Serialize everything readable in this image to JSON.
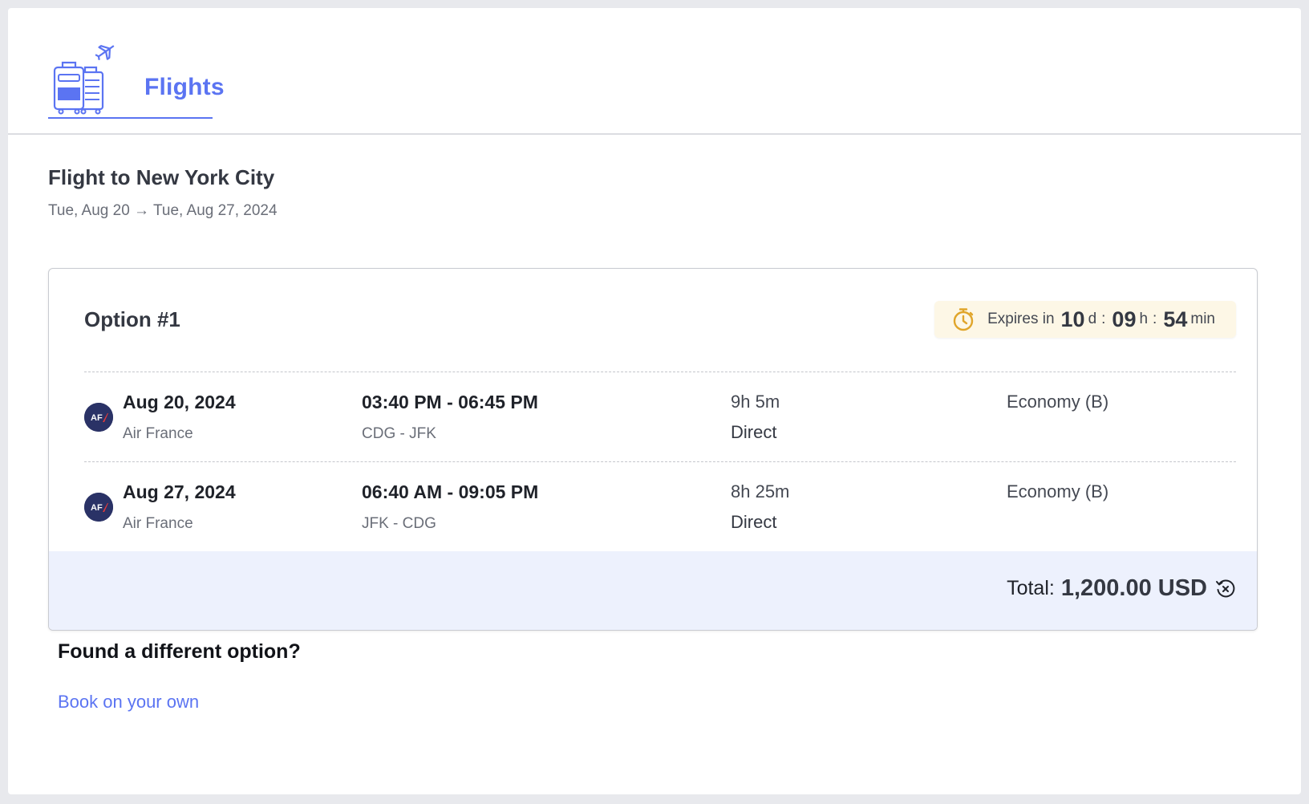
{
  "header": {
    "brand_label": "Flights",
    "brand_icon": "luggage-plane-icon"
  },
  "trip": {
    "title": "Flight to New York City",
    "dates": "Tue, Aug 20 → Tue, Aug 27, 2024"
  },
  "option": {
    "title": "Option #1",
    "expires": {
      "prefix": "Expires in",
      "days": "10",
      "days_unit": "d",
      "hours": "09",
      "hours_unit": "h",
      "minutes": "54",
      "minutes_unit": "min",
      "separator": ":"
    },
    "flights": [
      {
        "date": "Aug 20, 2024",
        "airline": "Air France",
        "airline_code": "AF",
        "time": "03:40 PM - 06:45 PM",
        "route": "CDG - JFK",
        "duration": "9h 5m",
        "stops": "Direct",
        "cabin": "Economy (B)"
      },
      {
        "date": "Aug 27, 2024",
        "airline": "Air France",
        "airline_code": "AF",
        "time": "06:40 AM - 09:05 PM",
        "route": "JFK - CDG",
        "duration": "8h 25m",
        "stops": "Direct",
        "cabin": "Economy (B)"
      }
    ],
    "total": {
      "label": "Total:",
      "amount": "1,200.00 USD"
    }
  },
  "alternative": {
    "heading": "Found a different option?",
    "link_label": "Book on your own"
  },
  "colors": {
    "accent": "#5B74F2",
    "timer": "#E0A52A",
    "airline_logo_bg": "#2A3266",
    "airline_logo_red": "#E23B3B",
    "total_bar_bg": "#EDF1FD",
    "expires_bg": "#FDF7E6"
  }
}
